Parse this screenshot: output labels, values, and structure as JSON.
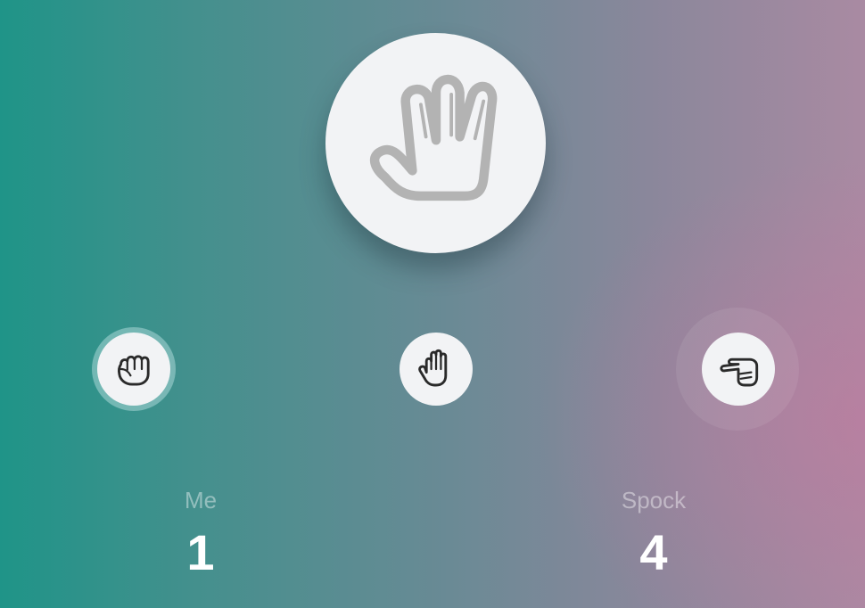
{
  "opponent_choice": {
    "icon": "vulcan-salute-icon"
  },
  "options": [
    {
      "id": "rock",
      "icon": "rock-fist-icon",
      "selected": true
    },
    {
      "id": "paper",
      "icon": "paper-hand-icon",
      "selected": false
    },
    {
      "id": "scissors",
      "icon": "scissors-hand-icon",
      "selected": false
    }
  ],
  "scores": {
    "me": {
      "label": "Me",
      "value": "1"
    },
    "opponent": {
      "label": "Spock",
      "value": "4"
    }
  },
  "colors": {
    "background_left": "#1f9488",
    "background_right": "#a98aa2",
    "button_fill": "#f2f3f5",
    "icon_stroke": "#2a2a2a",
    "big_icon_stroke": "#b3b3b3",
    "score_label": "#c6d3d6",
    "score_value": "#ffffff"
  }
}
